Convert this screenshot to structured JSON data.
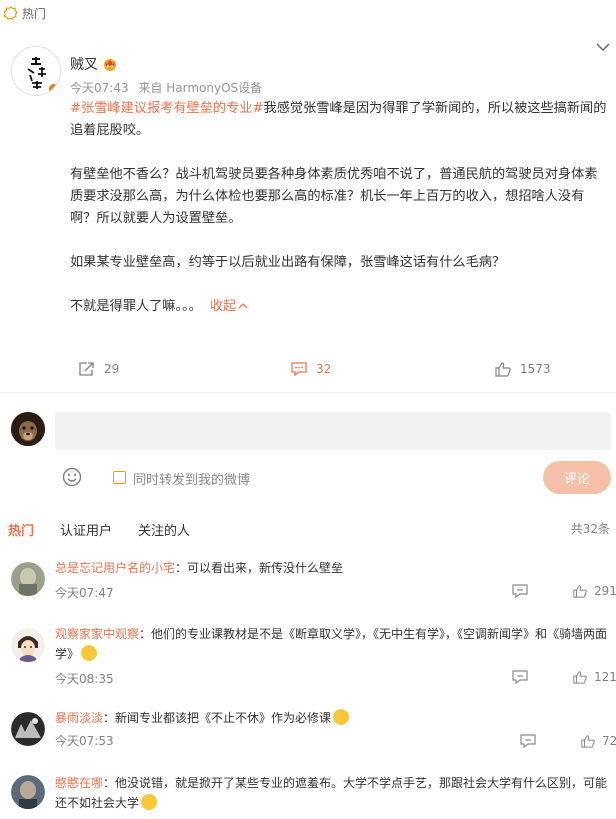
{
  "header": {
    "label": "热门"
  },
  "post": {
    "author": "贼叉",
    "time": "今天07:43",
    "source": "来自 HarmonyOS设备",
    "topic": "#张雪峰建议报考有壁垒的专业#",
    "para1_rest": "我感觉张雪峰是因为得罪了学新闻的，所以被这些搞新闻的追着屁股咬。",
    "para2": "有壁垒他不香么？战斗机驾驶员要各种身体素质优秀咱不说了，普通民航的驾驶员对身体素质要求没那么高，为什么体检也要那么高的标准？机长一年上百万的收入，想招啥人没有啊？所以就要人为设置壁垒。",
    "para3": "如果某专业壁垒高，约等于以后就业出路有保障，张雪峰这话有什么毛病？",
    "para4": "不就是得罪人了嘛。。。",
    "collapse_label": "收起",
    "forward_count": "29",
    "comment_count": "32",
    "like_count": "1573"
  },
  "composer": {
    "placeholder": "",
    "forward_label": "同时转发到我的微博",
    "submit_label": "评论"
  },
  "tabs": [
    "热门",
    "认证用户",
    "关注的人"
  ],
  "total": "共32条",
  "comments": [
    {
      "name": "总是忘记用户名的小宅",
      "text": "：可以看出来，新传没什么壁垒",
      "time": "今天07:47",
      "likes": "291"
    },
    {
      "name": "观察家家中观察",
      "text": "：他们的专业课教材是不是《断章取义学》，《无中生有学》，《空调新闻学》和《骑墙两面学》",
      "time": "今天08:35",
      "likes": "121"
    },
    {
      "name": "暴雨淡淡",
      "text": "：新闻专业都该把《不止不休》作为必修课",
      "time": "今天07:53",
      "likes": "72"
    },
    {
      "name": "憨憨在哪",
      "text": "：他没说错，就是掀开了某些专业的遮羞布。大学不学点手艺，那跟社会大学有什么区别，可能还不如社会大学",
      "time": "",
      "likes": ""
    }
  ],
  "colors": {
    "accent": "#eb7350",
    "submit_disabled": "#f6c0a8",
    "checkbox": "#f39800"
  }
}
